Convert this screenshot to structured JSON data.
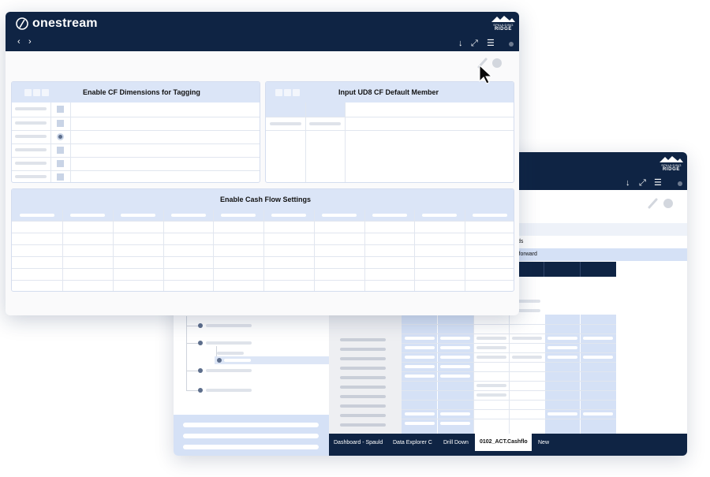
{
  "app": {
    "brand": "onestream",
    "partner_logo_line1": "SPAULDING",
    "partner_logo_line2": "RIDGE"
  },
  "front_window": {
    "panels": [
      {
        "title": "Enable CF Dimensions for Tagging"
      },
      {
        "title": "Input UD8 CF Default Member"
      },
      {
        "title": "Enable Cash Flow Settings"
      }
    ]
  },
  "back_window": {
    "row_labels": [
      "ds",
      "lforward"
    ],
    "tabs": [
      {
        "label": "Dashboard - Spauld",
        "active": false
      },
      {
        "label": "Data Explorer C",
        "active": false
      },
      {
        "label": "Drill Down",
        "active": false
      },
      {
        "label": "0102_ACT.Cashflo",
        "active": true
      },
      {
        "label": "New",
        "active": false
      }
    ]
  },
  "colors": {
    "header_navy": "#0f2444",
    "panel_header": "#dbe5f7",
    "accent_blue": "#d5e1f6"
  }
}
